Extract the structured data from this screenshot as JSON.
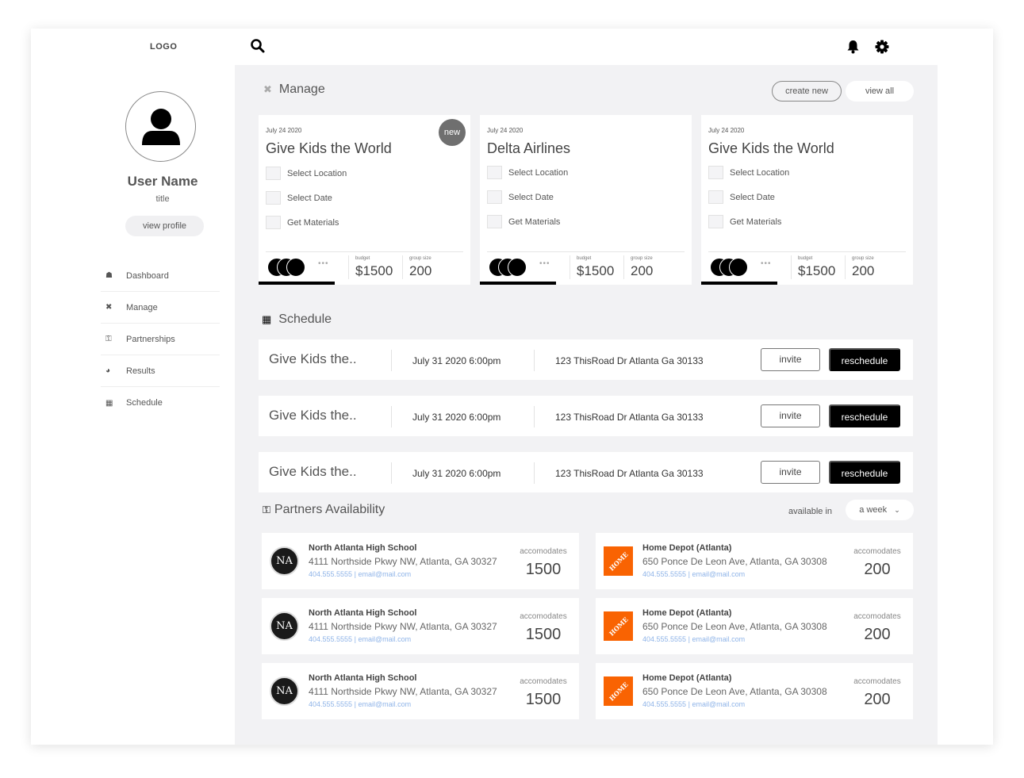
{
  "app": {
    "logo": "LOGO"
  },
  "profile": {
    "name": "User Name",
    "title": "title",
    "view_profile_label": "view profile"
  },
  "nav": {
    "items": [
      {
        "label": "Dashboard",
        "icon": "home-icon"
      },
      {
        "label": "Manage",
        "icon": "tools-icon"
      },
      {
        "label": "Partnerships",
        "icon": "handshake-icon"
      },
      {
        "label": "Results",
        "icon": "results-icon"
      },
      {
        "label": "Schedule",
        "icon": "calendar-icon"
      }
    ]
  },
  "topbar": {
    "search_icon": "search-icon",
    "bell_icon": "bell-icon",
    "gear_icon": "gear-icon"
  },
  "manage": {
    "title": "Manage",
    "create_new_label": "create new",
    "view_all_label": "view all",
    "badge_label": "new",
    "cards": [
      {
        "date": "July 24 2020",
        "title": "Give Kids the World",
        "is_new": true,
        "tasks": [
          "Select Location",
          "Select Date",
          "Get Materials"
        ],
        "budget_label": "budget",
        "budget": "$1500",
        "group_label": "group size",
        "group": "200",
        "more": "•••",
        "progress": 0.36
      },
      {
        "date": "July 24 2020",
        "title": "Delta Airlines",
        "is_new": false,
        "tasks": [
          "Select Location",
          "Select Date",
          "Get Materials"
        ],
        "budget_label": "budget",
        "budget": "$1500",
        "group_label": "group size",
        "group": "200",
        "more": "•••",
        "progress": 0.36
      },
      {
        "date": "July 24 2020",
        "title": "Give Kids the World",
        "is_new": false,
        "tasks": [
          "Select Location",
          "Select Date",
          "Get Materials"
        ],
        "budget_label": "budget",
        "budget": "$1500",
        "group_label": "group size",
        "group": "200",
        "more": "•••",
        "progress": 0.36
      }
    ]
  },
  "schedule": {
    "title": "Schedule",
    "rows": [
      {
        "title": "Give Kids the..",
        "datetime": "July 31 2020 6:00pm",
        "address": "123 ThisRoad Dr Atlanta Ga 30133",
        "invite_label": "invite",
        "reschedule_label": "reschedule"
      },
      {
        "title": "Give Kids the..",
        "datetime": "July 31 2020 6:00pm",
        "address": "123 ThisRoad Dr Atlanta Ga 30133",
        "invite_label": "invite",
        "reschedule_label": "reschedule"
      },
      {
        "title": "Give Kids the..",
        "datetime": "July 31 2020 6:00pm",
        "address": "123 ThisRoad Dr Atlanta Ga 30133",
        "invite_label": "invite",
        "reschedule_label": "reschedule"
      }
    ]
  },
  "partners": {
    "title": "Partners Availability",
    "available_in_label": "available in",
    "range_value": "a week",
    "list": [
      {
        "logo": "NA",
        "name": "North Atlanta High School",
        "address": "4111 Northside Pkwy NW, Atlanta, GA 30327",
        "phone": "404.555.5555",
        "sep": "|",
        "email": "email@mail.com",
        "acc_label": "accomodates",
        "accommodates": "1500"
      },
      {
        "logo": "THE HOME DEPOT",
        "name": "Home Depot (Atlanta)",
        "address": "650 Ponce De Leon Ave, Atlanta, GA 30308",
        "phone": "404.555.5555",
        "sep": "|",
        "email": "email@mail.com",
        "acc_label": "accomodates",
        "accommodates": "200"
      },
      {
        "logo": "NA",
        "name": "North Atlanta High School",
        "address": "4111 Northside Pkwy NW, Atlanta, GA 30327",
        "phone": "404.555.5555",
        "sep": "|",
        "email": "email@mail.com",
        "acc_label": "accomodates",
        "accommodates": "1500"
      },
      {
        "logo": "THE HOME DEPOT",
        "name": "Home Depot (Atlanta)",
        "address": "650 Ponce De Leon Ave, Atlanta, GA 30308",
        "phone": "404.555.5555",
        "sep": "|",
        "email": "email@mail.com",
        "acc_label": "accomodates",
        "accommodates": "200"
      },
      {
        "logo": "NA",
        "name": "North Atlanta High School",
        "address": "4111 Northside Pkwy NW, Atlanta, GA 30327",
        "phone": "404.555.5555",
        "sep": "|",
        "email": "email@mail.com",
        "acc_label": "accomodates",
        "accommodates": "1500"
      },
      {
        "logo": "THE HOME DEPOT",
        "name": "Home Depot (Atlanta)",
        "address": "650 Ponce De Leon Ave, Atlanta, GA 30308",
        "phone": "404.555.5555",
        "sep": "|",
        "email": "email@mail.com",
        "acc_label": "accomodates",
        "accommodates": "200"
      }
    ]
  },
  "colors": {
    "accent": "#000000",
    "panel_bg": "#f2f2f4",
    "link": "#8fb4e8",
    "home_depot_orange": "#f96302"
  }
}
